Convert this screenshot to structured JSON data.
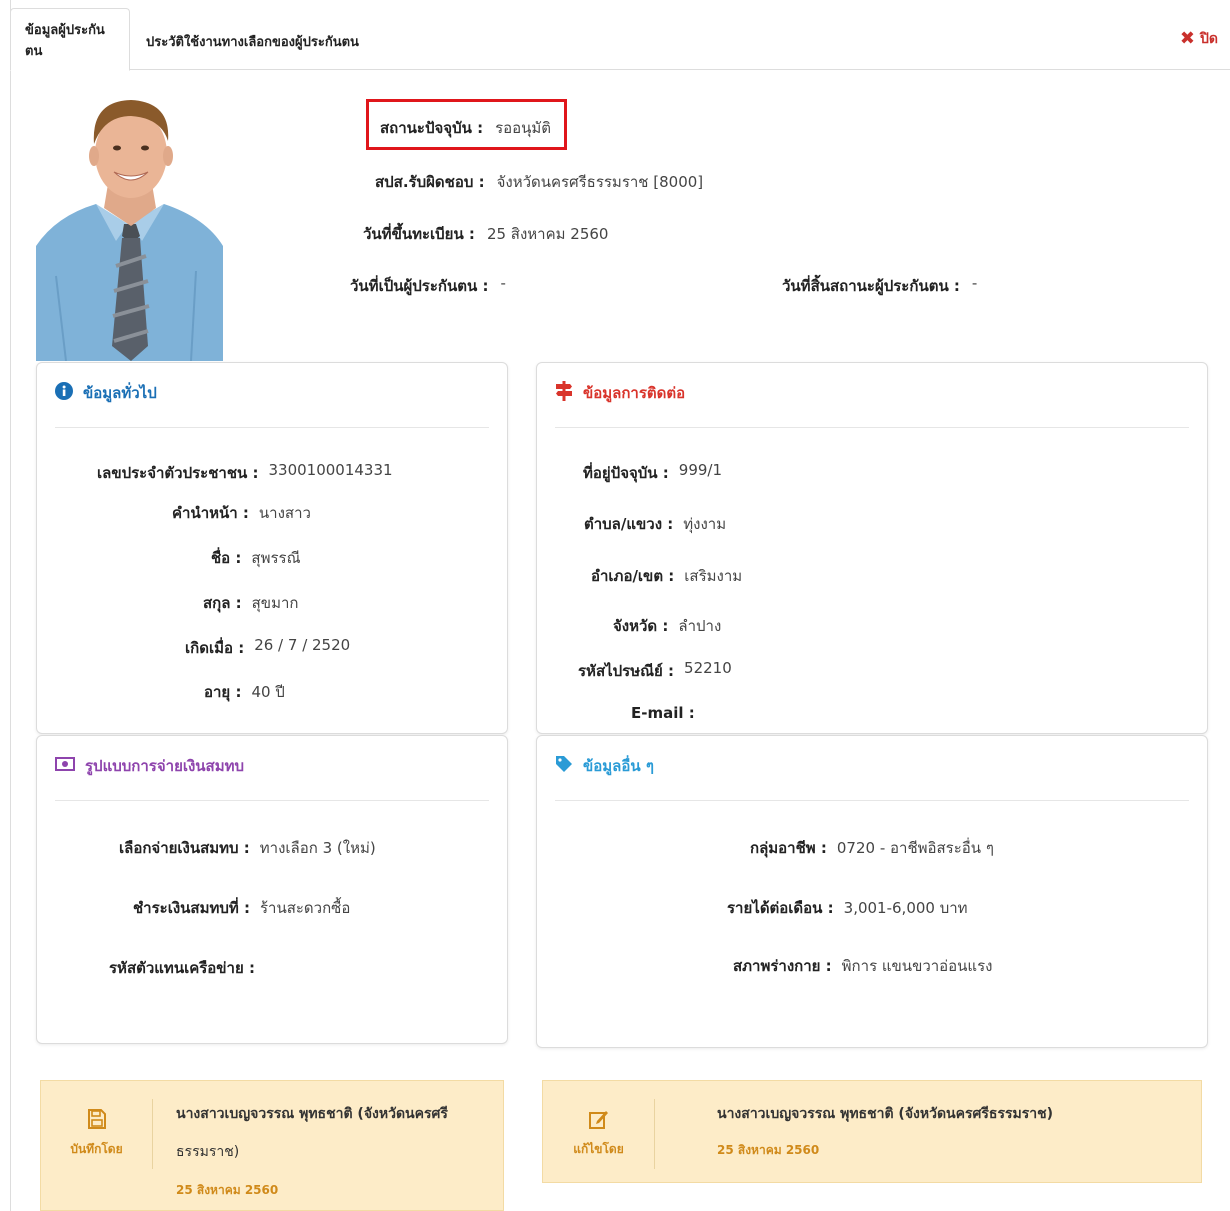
{
  "tabs": [
    {
      "label": "ข้อมูลผู้ประกันตน"
    },
    {
      "label": "ประวัติใช้งานทางเลือกของผู้ประกันตน"
    }
  ],
  "close": {
    "label": "ปิด"
  },
  "status": {
    "current_label": "สถานะปัจจุบัน :",
    "current_value": "รออนุมัติ",
    "office_label": "สปส.รับผิดชอบ :",
    "office_value": "จังหวัดนครศรีธรรมราช [8000]",
    "reg_label": "วันที่ขึ้นทะเบียน :",
    "reg_value": "25 สิงหาคม 2560",
    "insured_label": "วันที่เป็นผู้ประกันตน :",
    "insured_value": "-",
    "end_label": "วันที่สิ้นสถานะผู้ประกันตน :",
    "end_value": "-"
  },
  "general": {
    "title": "ข้อมูลทั่วไป",
    "rows": [
      {
        "label": "เลขประจำตัวประชาชน :",
        "value": "3300100014331"
      },
      {
        "label": "คำนำหน้า :",
        "value": "นางสาว"
      },
      {
        "label": "ชื่อ :",
        "value": "สุพรรณี"
      },
      {
        "label": "สกุล :",
        "value": "สุขมาก"
      },
      {
        "label": "เกิดเมื่อ :",
        "value": "26 / 7 / 2520"
      },
      {
        "label": "อายุ :",
        "value": "40 ปี"
      }
    ]
  },
  "contact": {
    "title": "ข้อมูลการติดต่อ",
    "rows": [
      {
        "label": "ที่อยู่ปัจจุบัน :",
        "value": "999/1"
      },
      {
        "label": "ตำบล/แขวง :",
        "value": "ทุ่งงาม"
      },
      {
        "label": "อำเภอ/เขต :",
        "value": "เสริมงาม"
      },
      {
        "label": "จังหวัด :",
        "value": "ลำปาง"
      },
      {
        "label": "รหัสไปรษณีย์ :",
        "value": "52210"
      },
      {
        "label": "E-mail :",
        "value": ""
      }
    ]
  },
  "payment": {
    "title": "รูปแบบการจ่ายเงินสมทบ",
    "rows": [
      {
        "label": "เลือกจ่ายเงินสมทบ :",
        "value": "ทางเลือก 3 (ใหม่)"
      },
      {
        "label": "ชำระเงินสมทบที่ :",
        "value": "ร้านสะดวกซื้อ"
      },
      {
        "label": "รหัสตัวแทนเครือข่าย :",
        "value": ""
      }
    ]
  },
  "other": {
    "title": "ข้อมูลอื่น ๆ",
    "rows": [
      {
        "label": "กลุ่มอาชีพ :",
        "value": "0720  - อาชีพอิสระอื่น ๆ"
      },
      {
        "label": "รายได้ต่อเดือน :",
        "value": "3,001-6,000 บาท"
      },
      {
        "label": "สภาพร่างกาย :",
        "value": "พิการ แขนขวาอ่อนแรง"
      }
    ]
  },
  "saved": {
    "label": "บันทึกโดย",
    "name_line1": "นางสาวเบญจวรรณ พุทธชาติ  (จังหวัดนครศรี",
    "name_line2": "ธรรมราช)",
    "date": "25 สิงหาคม 2560"
  },
  "edited": {
    "label": "แก้ไขโดย",
    "name": "นางสาวเบญจวรรณ พุทธชาติ  (จังหวัดนครศรีธรรมราช)",
    "date": "25 สิงหาคม 2560"
  },
  "colors": {
    "general": "#1a6fb5",
    "contact": "#d9342b",
    "payment": "#8e44ad",
    "other": "#2a9bd6",
    "footer_accent": "#d08a1a",
    "status_highlight": "#e0161b"
  },
  "icons": {
    "general": "info-circle-icon",
    "contact": "signpost-icon",
    "payment": "money-icon",
    "other": "tag-icon",
    "saved": "floppy-disk-icon",
    "edited": "edit-icon",
    "close": "close-icon"
  }
}
